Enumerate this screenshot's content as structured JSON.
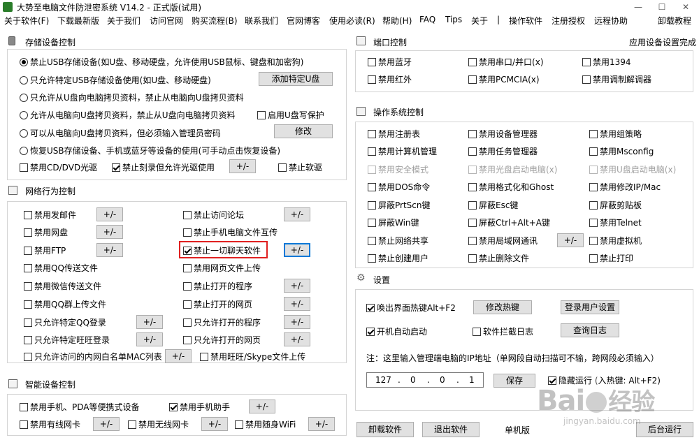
{
  "window": {
    "title": "大势至电脑文件防泄密系统 V14.2 - 正式版(试用)",
    "min": "—",
    "max": "☐",
    "close": "✕"
  },
  "menu": {
    "items": [
      "关于软件(F)",
      "下载最新版",
      "关于我们",
      "访问官网",
      "购买流程(B)",
      "联系我们",
      "官网博客",
      "使用必读(R)",
      "帮助(H)",
      "FAQ",
      "Tips",
      "关于",
      "|",
      "操作软件",
      "注册授权",
      "远程协助",
      "卸载教程"
    ]
  },
  "storage": {
    "title": "存储设备控制",
    "options": [
      "禁止USB存储设备(如U盘、移动硬盘，允许使用USB鼠标、键盘和加密狗)",
      "只允许特定USB存储设备使用(如U盘、移动硬盘)",
      "只允许从U盘向电脑拷贝资料，禁止从电脑向U盘拷贝资料",
      "允许从电脑向U盘拷贝资料，禁止从U盘向电脑拷贝资料",
      "可以从电脑向U盘拷贝资料，但必须输入管理员密码",
      "恢复USB存储设备、手机或蓝牙等设备的使用(可手动点击恢复设备)"
    ],
    "selected_index": 0,
    "add_usb_button": "添加特定U盘",
    "write_protect": "启用U盘写保护",
    "modify_button": "修改",
    "cd_dvd": "禁用CD/DVD光驱",
    "burn": "禁止刻录但允许光驱使用",
    "plusminus": "+/-",
    "floppy": "禁止软驱"
  },
  "network": {
    "title": "网络行为控制",
    "left": [
      "禁用发邮件",
      "禁用网盘",
      "禁用FTP",
      "禁用QQ传送文件",
      "禁用微信传送文件",
      "禁用QQ群上传文件",
      "只允许特定QQ登录",
      "只允许特定旺旺登录",
      "只允许访问的内网白名单MAC列表"
    ],
    "right": [
      "禁止访问论坛",
      "禁止手机电脑文件互传",
      "禁止一切聊天软件",
      "禁用网页文件上传",
      "禁止打开的程序",
      "禁止打开的网页",
      "只允许打开的程序",
      "只允许打开的网页",
      "禁用旺旺/Skype文件上传"
    ],
    "plusminus": "+/-"
  },
  "smart": {
    "title": "智能设备控制",
    "items": [
      "禁用手机、PDA等便携式设备",
      "禁用手机助手",
      "禁用有线网卡",
      "禁用无线网卡",
      "禁用随身WiFi"
    ],
    "plusminus": "+/-"
  },
  "port": {
    "title": "端口控制",
    "app_link": "应用设备设置完成",
    "items": [
      "禁用蓝牙",
      "禁用串口/并口(x)",
      "禁用1394",
      "禁用红外",
      "禁用PCMCIA(x)",
      "禁用调制解调器"
    ]
  },
  "os": {
    "title": "操作系统控制",
    "rows": [
      [
        "禁用注册表",
        "禁用设备管理器",
        "禁用组策略"
      ],
      [
        "禁用计算机管理",
        "禁用任务管理器",
        "禁用Msconfig"
      ],
      [
        "禁用安全模式",
        "禁用光盘启动电脑(x)",
        "禁用U盘启动电脑(x)"
      ],
      [
        "禁用DOS命令",
        "禁用格式化和Ghost",
        "禁用修改IP/Mac"
      ],
      [
        "屏蔽PrtScn键",
        "屏蔽Esc键",
        "屏蔽剪贴板"
      ],
      [
        "屏蔽Win键",
        "屏蔽Ctrl+Alt+A键",
        "禁用Telnet"
      ],
      [
        "禁止网络共享",
        "禁用局域网通讯",
        "禁用虚拟机"
      ],
      [
        "禁止创建用户",
        "禁止删除文件",
        "禁止打印"
      ]
    ],
    "plusminus": "+/-"
  },
  "settings": {
    "title": "设置",
    "hotkey": "唤出界面热键Alt+F2",
    "modify_hotkey": "修改热键",
    "login_user": "登录用户设置",
    "autostart": "开机自动启动",
    "intercept_log": "软件拦截日志",
    "query_log": "查询日志",
    "note": "注：这里输入管理端电脑的IP地址（单网段自动扫描可不输，跨网段必须输入）",
    "ip": [
      "127",
      "0",
      "0",
      "1"
    ],
    "save": "保存",
    "hidden_run": "隐藏运行",
    "hidden_run_tail": "入热键: Alt+F2)"
  },
  "bottom": {
    "uninstall": "卸载软件",
    "exit": "退出软件",
    "single": "单机版",
    "background": "后台运行"
  },
  "watermark": {
    "main": "Bai",
    "jingyan": "经验",
    "url": "jingyan.baidu.com"
  }
}
